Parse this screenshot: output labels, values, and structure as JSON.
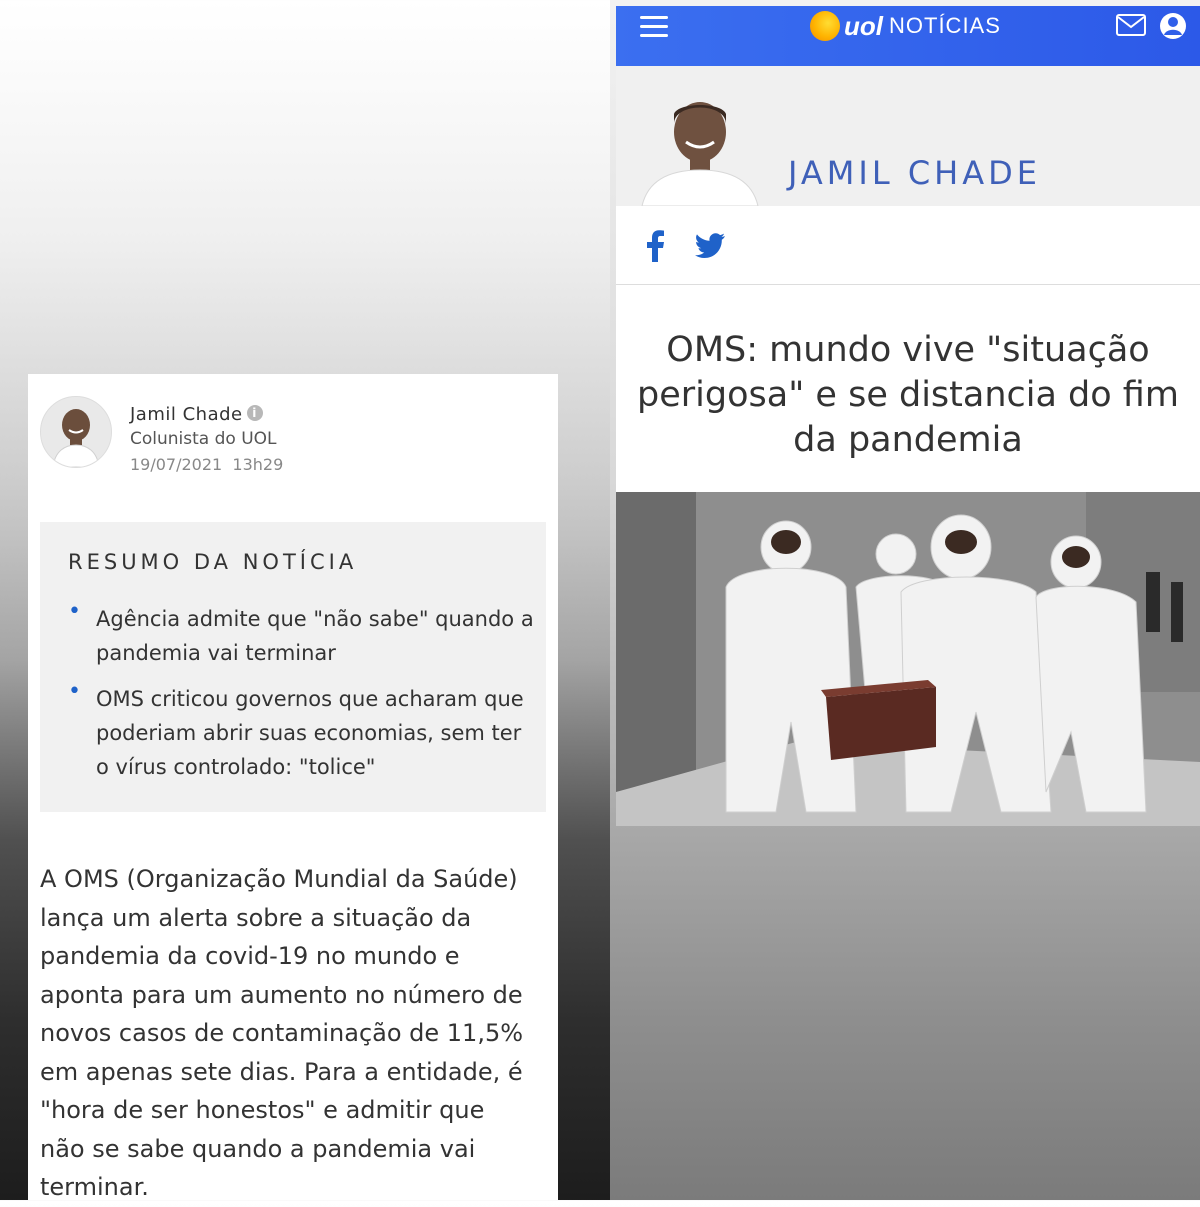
{
  "left_panel": {
    "author": {
      "name": "Jamil Chade",
      "role": "Colunista do UOL",
      "date": "19/07/2021",
      "time": "13h29"
    },
    "summary": {
      "title": "RESUMO DA NOTÍCIA",
      "items": [
        {
          "text": "Agência admite que \"não sabe\" quando a pandemia vai terminar"
        },
        {
          "text": "OMS criticou governos que acharam que poderiam abrir suas economias, sem ter o vírus controlado: \"tolice\""
        }
      ]
    },
    "body_paragraph": "A OMS (Organização Mundial da Saúde) lança um alerta sobre a situação da pandemia da covid-19 no mundo e aponta para um aumento no número de novos casos de contaminação de 11,5% em apenas sete dias. Para a entidade, é \"hora de ser honestos\" e admitir que não se sabe quando a pandemia vai terminar."
  },
  "right_panel": {
    "header": {
      "logo_text": "uol",
      "section": "NOTÍCIAS",
      "accent_color": "#2f5fe9"
    },
    "banner": {
      "author_name": "JAMIL CHADE"
    },
    "social": {
      "icons": [
        "facebook-icon",
        "twitter-icon"
      ],
      "color": "#1f62c9"
    },
    "headline": "OMS: mundo vive \"situação perigosa\" e se distancia do fim da pandemia"
  }
}
